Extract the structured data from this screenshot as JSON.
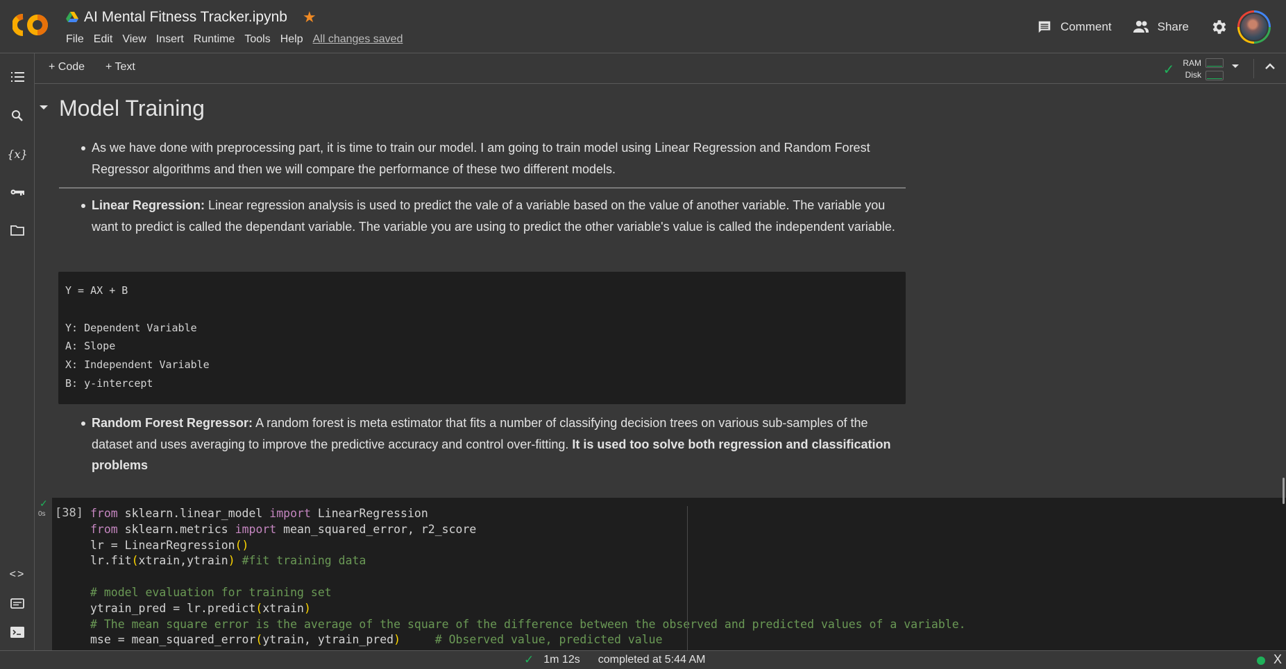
{
  "header": {
    "doc_title": "AI Mental Fitness Tracker.ipynb",
    "menu": [
      "File",
      "Edit",
      "View",
      "Insert",
      "Runtime",
      "Tools",
      "Help"
    ],
    "save_status": "All changes saved",
    "comment_label": "Comment",
    "share_label": "Share"
  },
  "toolbar": {
    "add_code_label": "+ Code",
    "add_text_label": "+ Text",
    "ram_label": "RAM",
    "disk_label": "Disk"
  },
  "rail": {
    "icons": [
      "table-of-contents-icon",
      "search-icon",
      "variables-icon",
      "secrets-key-icon",
      "files-folder-icon",
      "code-snippets-icon",
      "command-palette-icon",
      "terminal-icon"
    ]
  },
  "notebook": {
    "section_title": "Model Training",
    "intro_bullet": "As we have done with preprocessing part, it is time to train our model. I am going to train model using Linear Regression and Random Forest Regressor algorithms and then we will compare the performance of these two different models.",
    "linear_regression": {
      "term": "Linear Regression:",
      "text": " Linear regression analysis is used to predict the vale of a variable based on the value of another variable. The variable you want to predict is called the dependant variable. The variable you are using to predict the other variable's value is called the independent variable."
    },
    "formula_block": [
      "Y = AX + B",
      "",
      "Y: Dependent Variable",
      "A: Slope",
      "X: Independent Variable",
      "B: y-intercept"
    ],
    "random_forest": {
      "term": "Random Forest Regressor:",
      "text": " A random forest is meta estimator that fits a number of classifying decision trees on various sub-samples of the dataset and uses averaging to improve the predictive accuracy and control over-fitting. ",
      "emphasis": "It is used too solve both regression and classification problems"
    },
    "code_cell": {
      "execution_count": "[38]",
      "exec_time": "0s",
      "status": "success",
      "lines": [
        [
          {
            "t": "from",
            "c": "kw"
          },
          {
            "t": " sklearn.linear_model "
          },
          {
            "t": "import",
            "c": "kw"
          },
          {
            "t": " LinearRegression"
          }
        ],
        [
          {
            "t": "from",
            "c": "kw"
          },
          {
            "t": " sklearn.metrics "
          },
          {
            "t": "import",
            "c": "kw"
          },
          {
            "t": " mean_squared_error, r2_score"
          }
        ],
        [
          {
            "t": "lr = LinearRegression"
          },
          {
            "t": "()",
            "c": "pn"
          }
        ],
        [
          {
            "t": "lr.fit"
          },
          {
            "t": "(",
            "c": "pn"
          },
          {
            "t": "xtrain,ytrain"
          },
          {
            "t": ")",
            "c": "pn"
          },
          {
            "t": " "
          },
          {
            "t": "#fit training data",
            "c": "cm"
          }
        ],
        [],
        [
          {
            "t": "# model evaluation for training set",
            "c": "cm"
          }
        ],
        [
          {
            "t": "ytrain_pred = lr.predict"
          },
          {
            "t": "(",
            "c": "pn"
          },
          {
            "t": "xtrain"
          },
          {
            "t": ")",
            "c": "pn"
          }
        ],
        [
          {
            "t": "# The mean square error is the average of the square of the difference between the observed and predicted values of a variable.",
            "c": "cm"
          }
        ],
        [
          {
            "t": "mse = mean_squared_error"
          },
          {
            "t": "(",
            "c": "pn"
          },
          {
            "t": "ytrain, ytrain_pred"
          },
          {
            "t": ")",
            "c": "pn"
          },
          {
            "t": "     "
          },
          {
            "t": "# Observed value, predicted value",
            "c": "cm"
          }
        ]
      ]
    }
  },
  "statusbar": {
    "duration": "1m 12s",
    "completed": "completed at 5:44 AM",
    "close_label": "X"
  },
  "colors": {
    "background": "#383838",
    "code_background": "#1e1e1e",
    "success_green": "#1fb15a",
    "star_orange": "#f08a24",
    "keyword": "#c586c0",
    "comment": "#6a9955",
    "bracket": "#ffd700"
  }
}
